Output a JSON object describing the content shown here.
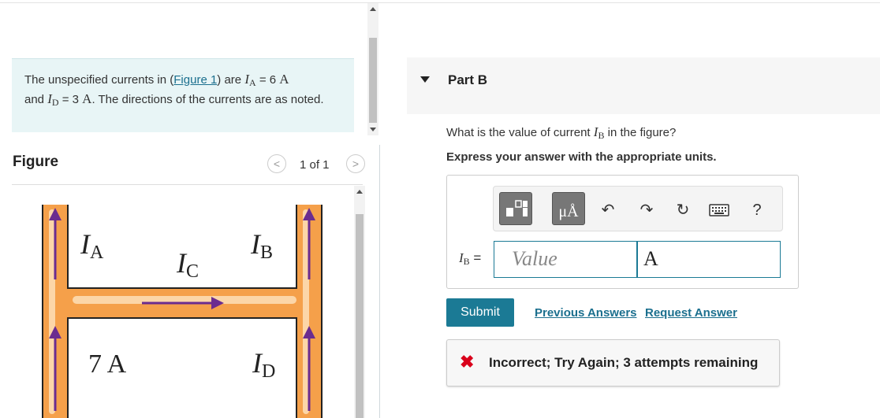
{
  "problem": {
    "text_pre": "The unspecified currents in (",
    "figure_link": "Figure 1",
    "text_mid1": ") are ",
    "IA_symbol": "I",
    "IA_sub": "A",
    "IA_value": " = 6 ",
    "IA_unit": "A",
    "text_and": "and ",
    "ID_symbol": "I",
    "ID_sub": "D",
    "ID_value": " = 3 ",
    "ID_unit": "A",
    "text_end": ". The directions of the currents are as noted."
  },
  "figure": {
    "title": "Figure",
    "prev": "<",
    "next": ">",
    "page_indicator": "1 of 1",
    "labels": {
      "IA": {
        "sym": "I",
        "sub": "A"
      },
      "IC": {
        "sym": "I",
        "sub": "C"
      },
      "IB": {
        "sym": "I",
        "sub": "B"
      },
      "ID": {
        "sym": "I",
        "sub": "D"
      },
      "seven": "7 A"
    },
    "colors": {
      "wire": "#f5a04a",
      "wire_light": "#fcd6a8",
      "arrow": "#6b2c8f",
      "frame": "#222222"
    }
  },
  "part": {
    "title": "Part B",
    "question_pre": "What is the value of current ",
    "question_sym": "I",
    "question_sub": "B",
    "question_post": " in the figure?",
    "instruction": "Express your answer with the appropriate units."
  },
  "toolbar": {
    "templates_icon": "templates-icon",
    "units_label": "μÅ",
    "undo": "↶",
    "redo": "↷",
    "reset": "↻",
    "keyboard_icon": "keyboard-icon",
    "help": "?"
  },
  "answer": {
    "label_sym": "I",
    "label_sub": "B",
    "label_eq": " =",
    "value_placeholder": "Value",
    "unit_value": "A"
  },
  "actions": {
    "submit": "Submit",
    "previous_answers": "Previous Answers",
    "request_answer": "Request Answer"
  },
  "feedback": {
    "icon": "✖",
    "text": "Incorrect; Try Again; 3 attempts remaining"
  }
}
